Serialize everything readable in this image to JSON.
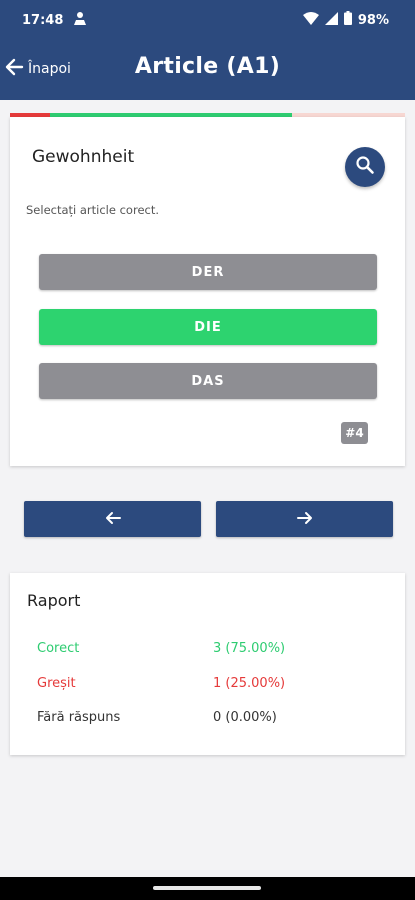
{
  "status_bar": {
    "time": "17:48",
    "battery": "98%"
  },
  "app_bar": {
    "back_label": "Înapoi",
    "title": "Article (A1)"
  },
  "progress": {
    "correct_fraction": 0.75,
    "incorrect_fraction": 0.25
  },
  "question": {
    "word": "Gewohnheit",
    "instruction": "Selectați article corect.",
    "options": [
      {
        "label": "DER",
        "state": "default"
      },
      {
        "label": "DIE",
        "state": "correct"
      },
      {
        "label": "DAS",
        "state": "default"
      }
    ],
    "number": "#4"
  },
  "report": {
    "title": "Raport",
    "rows": [
      {
        "label": "Corect",
        "value": "3 (75.00%)"
      },
      {
        "label": "Greșit",
        "value": "1 (25.00%)"
      },
      {
        "label": "Fără răspuns",
        "value": "0 (0.00%)"
      }
    ]
  },
  "colors": {
    "primary": "#2c4a7e",
    "correct": "#2dd36f",
    "incorrect": "#e53a3a",
    "neutral": "#8e8e93"
  },
  "icons": [
    "person-pin-icon",
    "wifi-icon",
    "signal-icon",
    "battery-icon",
    "arrow-back-icon",
    "search-icon",
    "arrow-left-icon",
    "arrow-right-icon"
  ]
}
